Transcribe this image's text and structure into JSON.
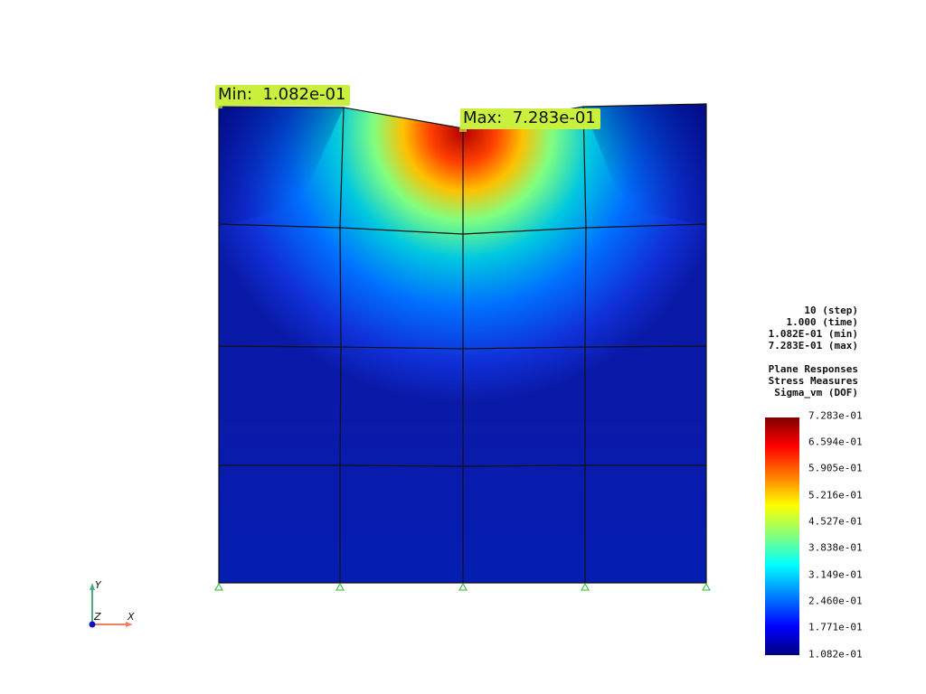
{
  "annotations": {
    "min": "Min:  1.082e-01",
    "max": "Max:  7.283e-01"
  },
  "info": {
    "step": "10 (step)",
    "time": "1.000 (time)",
    "min": "1.082E-01 (min)",
    "max": "7.283E-01 (max)",
    "category": "Plane Responses",
    "group": "Stress Measures",
    "field": "Sigma_vm (DOF)"
  },
  "colorbar": {
    "ticks": [
      "7.283e-01",
      "6.594e-01",
      "5.905e-01",
      "5.216e-01",
      "4.527e-01",
      "3.838e-01",
      "3.149e-01",
      "2.460e-01",
      "1.771e-01",
      "1.082e-01"
    ],
    "colors": [
      "#800000",
      "#ff0000",
      "#ff8000",
      "#ffff00",
      "#80ff80",
      "#00ffff",
      "#0080ff",
      "#0000ff",
      "#000080"
    ]
  },
  "axes": {
    "x": "X",
    "y": "Y",
    "z": "Z"
  }
}
